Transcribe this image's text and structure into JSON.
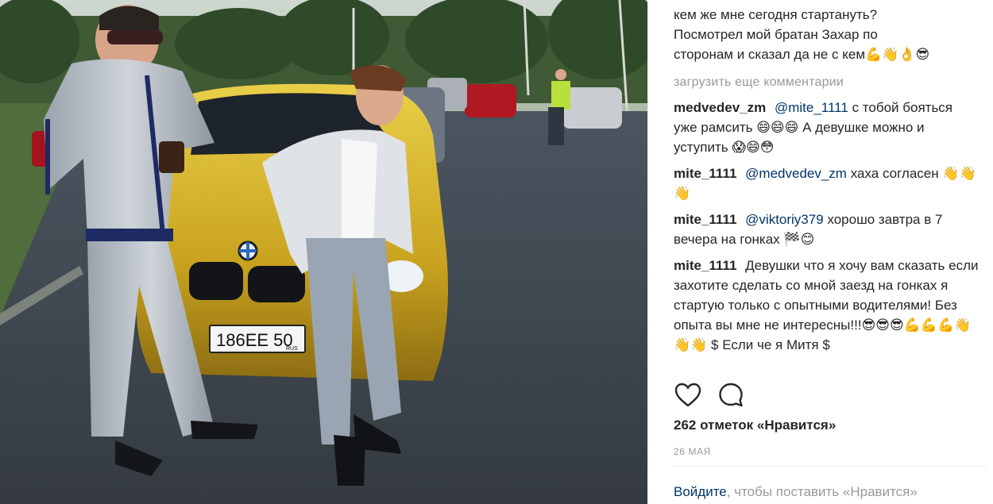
{
  "caption": {
    "lines": [
      "кем же мне сегодня стартануть?",
      "Посмотрел мой братан Захар по",
      "сторонам и сказал да не с кем💪👋👌😎"
    ]
  },
  "load_more": "загрузить еще комментарии",
  "comments": [
    {
      "user": "medvedev_zm",
      "mention": "@mite_1111",
      "text": "с тобой бояться уже рамсить 😄😄😄 А девушке можно и уступить 😱😄😳"
    },
    {
      "user": "mite_1111",
      "mention": "@medvedev_zm",
      "text": "хаха согласен 👋👋👋"
    },
    {
      "user": "mite_1111",
      "mention": "@viktoriy379",
      "text": "хорошо завтра в 7 вечера на гонках 🏁😊"
    },
    {
      "user": "mite_1111",
      "mention": "",
      "text": "Девушки что я хочу вам сказать если захотите сделать со мной заезд на гонках я стартую только с опытными водителями! Без опыта вы мне не интересны!!!😎😎😎💪💪💪👋👋👋 $ Если че я Митя $"
    }
  ],
  "actions": {
    "like_icon": "heart-icon",
    "comment_icon": "comment-icon"
  },
  "likes": "262 отметок «Нравится»",
  "date": "26 МАЯ",
  "login": {
    "link": "Войдите",
    "rest": ", чтобы поставить «Нравится»"
  },
  "photo": {
    "plate": "186EE 50",
    "plate_region": "RUS"
  },
  "colors": {
    "link": "#003569",
    "muted": "#999999",
    "text": "#262626",
    "car": "#d8b52a"
  }
}
